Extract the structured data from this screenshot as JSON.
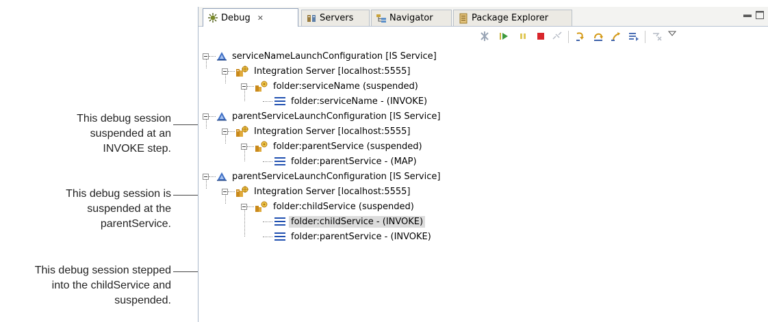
{
  "callouts": [
    {
      "text": "This debug session\nsuspended at an\nINVOKE step."
    },
    {
      "text": "This debug session is\nsuspended at the\nparentService."
    },
    {
      "text": "This debug session stepped\ninto the childService and\nsuspended."
    }
  ],
  "tabs": [
    {
      "label": "Debug",
      "icon": "debug-icon",
      "active": true
    },
    {
      "label": "Servers",
      "icon": "servers-icon"
    },
    {
      "label": "Navigator",
      "icon": "navigator-icon"
    },
    {
      "label": "Package Explorer",
      "icon": "package-explorer-icon"
    }
  ],
  "toolbar": {
    "icons": [
      "remove-terminated-icon",
      "resume-icon",
      "suspend-icon",
      "terminate-icon",
      "disconnect-icon",
      "step-into-icon",
      "step-over-icon",
      "step-return-icon",
      "drop-to-frame-icon",
      "use-step-filters-icon",
      "view-menu-icon"
    ]
  },
  "colors": {
    "launch": "#3f6fc5",
    "server": "#c9891a",
    "frame": "#1f4fb0",
    "selection": "#dcdcdc"
  },
  "tree": [
    {
      "label": "serviceNameLaunchConfiguration [IS Service]",
      "type": "launch",
      "level": 0
    },
    {
      "label": "Integration Server [localhost:5555]",
      "type": "server",
      "level": 1
    },
    {
      "label": "folder:serviceName (suspended)",
      "type": "thread",
      "level": 2
    },
    {
      "label": "folder:serviceName - (INVOKE)",
      "type": "frame",
      "level": 3
    },
    {
      "label": "parentServiceLaunchConfiguration [IS Service]",
      "type": "launch",
      "level": 0
    },
    {
      "label": "Integration Server [localhost:5555]",
      "type": "server",
      "level": 1
    },
    {
      "label": "folder:parentService (suspended)",
      "type": "thread",
      "level": 2
    },
    {
      "label": "folder:parentService - (MAP)",
      "type": "frame",
      "level": 3
    },
    {
      "label": "parentServiceLaunchConfiguration [IS Service]",
      "type": "launch",
      "level": 0
    },
    {
      "label": "Integration Server [localhost:5555]",
      "type": "server",
      "level": 1
    },
    {
      "label": "folder:childService (suspended)",
      "type": "thread",
      "level": 2
    },
    {
      "label": "folder:childService - (INVOKE)",
      "type": "frame",
      "level": 3,
      "selected": true
    },
    {
      "label": "folder:parentService - (INVOKE)",
      "type": "frame",
      "level": 3
    }
  ]
}
